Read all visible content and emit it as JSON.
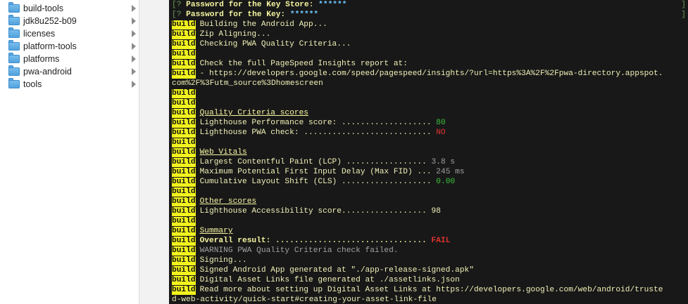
{
  "finder": {
    "items": [
      {
        "label": "build-tools"
      },
      {
        "label": "jdk8u252-b09"
      },
      {
        "label": "licenses"
      },
      {
        "label": "platform-tools"
      },
      {
        "label": "platforms"
      },
      {
        "label": "pwa-android"
      },
      {
        "label": "tools"
      }
    ]
  },
  "terminal": {
    "tag": "build",
    "pw_store_label": "Password for the Key Store: ",
    "pw_key_label": "Password for the Key: ",
    "masked": "******",
    "bracket_open": "[?",
    "bracket_close": "]",
    "l_building": "Building the Android App...",
    "l_zip": "Zip Aligning...",
    "l_checking": "Checking PWA Quality Criteria...",
    "l_check_report": "Check the full PageSpeed Insights report at:",
    "l_url1": "- https://developers.google.com/speed/pagespeed/insights/?url=https%3A%2F%2Fpwa-directory.appspot.",
    "l_url2": "com%2F%3Futm_source%3Dhomescreen",
    "h_quality": "Quality Criteria scores",
    "l_perf": "Lighthouse Performance score: ................... ",
    "v_perf": "80",
    "l_pwa": "Lighthouse PWA check: ........................... ",
    "v_pwa": "NO",
    "h_vitals": "Web Vitals",
    "l_lcp": "Largest Contentful Paint (LCP) ................. ",
    "v_lcp": "3.8 s",
    "l_fid": "Maximum Potential First Input Delay (Max FID) ... ",
    "v_fid": "245 ms",
    "l_cls": "Cumulative Layout Shift (CLS) ................... ",
    "v_cls": "0.00",
    "h_other": "Other scores",
    "l_access": "Lighthouse Accessibility score.................. ",
    "v_access": "98",
    "h_summary": "Summary",
    "l_overall": "Overall result: ................................ ",
    "v_overall": "FAIL",
    "l_warning": "WARNING PWA Quality Criteria check failed.",
    "l_signing": "Signing...",
    "l_signed": "Signed Android App generated at \"./app-release-signed.apk\"",
    "l_assetlinks": "Digital Asset Links file generated at ./assetlinks.json",
    "l_readmore": "Read more about setting up Digital Asset Links at https://developers.google.com/web/android/truste",
    "l_readmore2": "d-web-activity/quick-start#creating-your-asset-link-file"
  }
}
